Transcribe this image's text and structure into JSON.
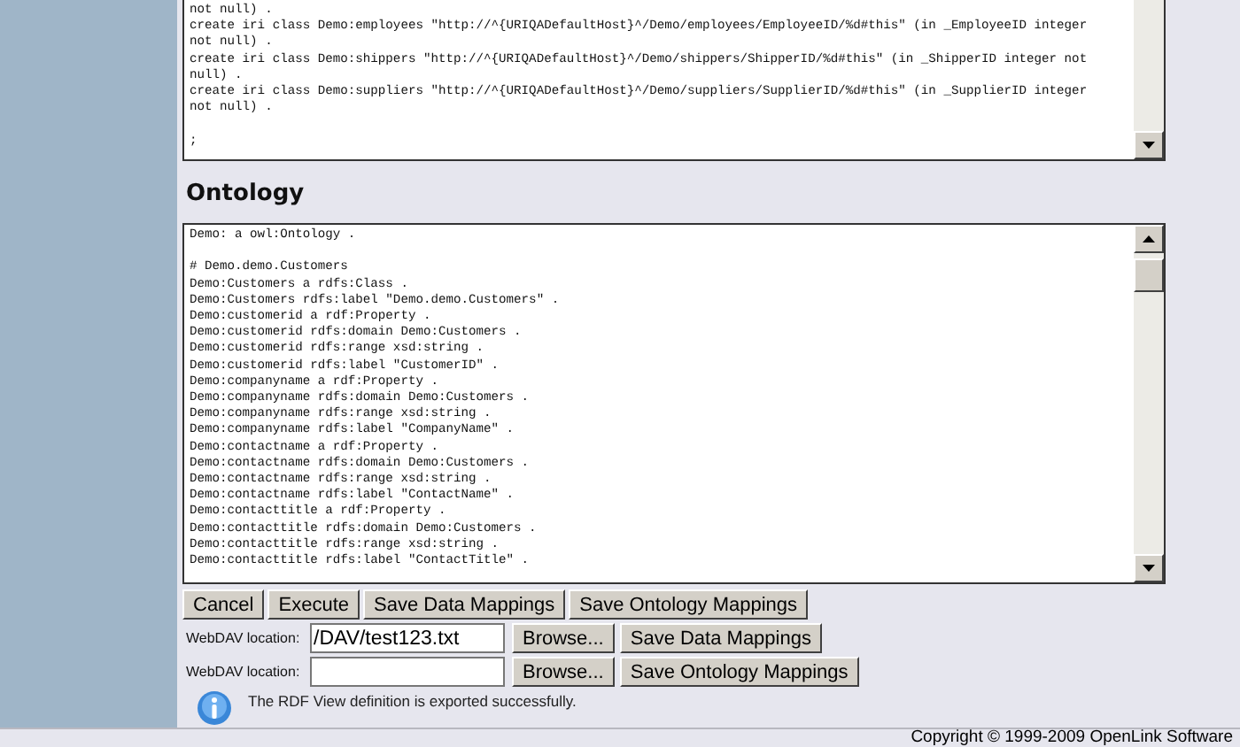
{
  "mappings_editor": {
    "blocks": [
      [
        "not null) .",
        "create iri class Demo:employees \"http://^{URIQADefaultHost}^/Demo/employees/EmployeeID/%d#this\" (in _EmployeeID integer",
        "not null) .",
        "create iri class Demo:shippers \"http://^{URIQADefaultHost}^/Demo/shippers/ShipperID/%d#this\" (in _ShipperID integer not",
        "null) .",
        "create iri class Demo:suppliers \"http://^{URIQADefaultHost}^/Demo/suppliers/SupplierID/%d#this\" (in _SupplierID integer",
        "not null) ."
      ],
      [
        ";"
      ]
    ]
  },
  "ontology": {
    "heading": "Ontology",
    "blocks": [
      [
        "Demo: a owl:Ontology ."
      ],
      [
        "# Demo.demo.Customers",
        "Demo:Customers a rdfs:Class .",
        "Demo:Customers rdfs:label \"Demo.demo.Customers\" .",
        "Demo:customerid a rdf:Property .",
        "Demo:customerid rdfs:domain Demo:Customers .",
        "Demo:customerid rdfs:range xsd:string .",
        "Demo:customerid rdfs:label \"CustomerID\" .",
        "Demo:companyname a rdf:Property .",
        "Demo:companyname rdfs:domain Demo:Customers .",
        "Demo:companyname rdfs:range xsd:string .",
        "Demo:companyname rdfs:label \"CompanyName\" .",
        "Demo:contactname a rdf:Property .",
        "Demo:contactname rdfs:domain Demo:Customers .",
        "Demo:contactname rdfs:range xsd:string .",
        "Demo:contactname rdfs:label \"ContactName\" .",
        "Demo:contacttitle a rdf:Property .",
        "Demo:contacttitle rdfs:domain Demo:Customers .",
        "Demo:contacttitle rdfs:range xsd:string .",
        "Demo:contacttitle rdfs:label \"ContactTitle\" ."
      ]
    ]
  },
  "action_buttons": [
    "Cancel",
    "Execute",
    "Save Data Mappings",
    "Save Ontology Mappings"
  ],
  "export_rows": [
    {
      "label": "WebDAV location:",
      "value": "/DAV/test123.txt",
      "browse": "Browse...",
      "save": "Save Data Mappings"
    },
    {
      "label": "WebDAV location:",
      "value": "",
      "browse": "Browse...",
      "save": "Save Ontology Mappings"
    }
  ],
  "message": "The RDF View definition is exported successfully.",
  "footer": "Copyright © 1999-2009 OpenLink Software"
}
